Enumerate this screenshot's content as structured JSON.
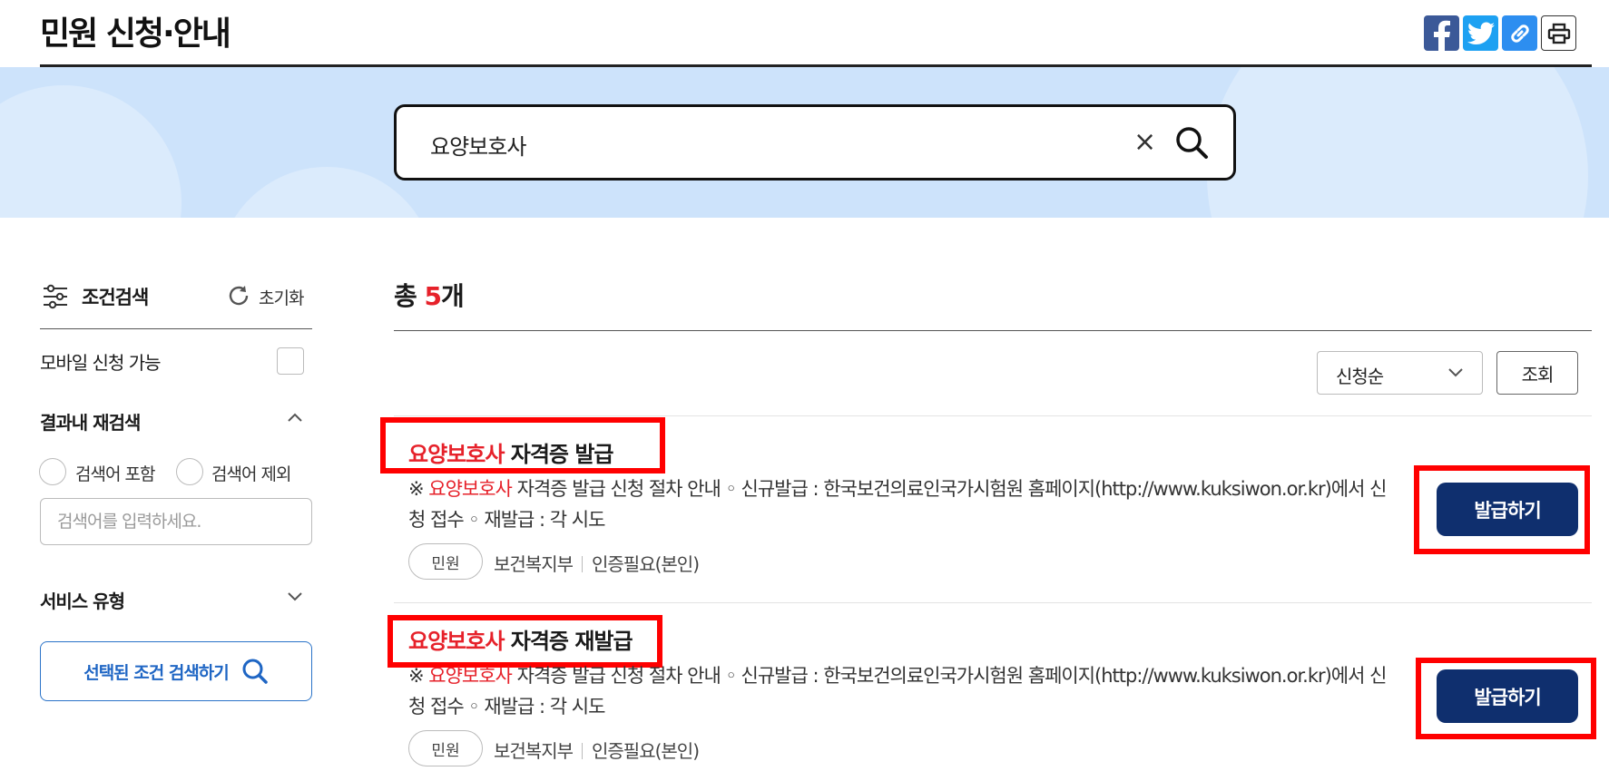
{
  "header": {
    "title": "민원 신청·안내",
    "share_buttons": [
      "facebook-icon",
      "twitter-icon",
      "link-icon",
      "print-icon"
    ]
  },
  "search": {
    "query": "요양보호사",
    "clear_glyph": "×"
  },
  "sidebar": {
    "title": "조건검색",
    "reset_label": "초기화",
    "mobile_label": "모바일 신청 가능",
    "refine_title": "결과내 재검색",
    "radio_include": "검색어 포함",
    "radio_exclude": "검색어 제외",
    "refine_placeholder": "검색어를 입력하세요.",
    "service_title": "서비스 유형",
    "apply_label": "선택된 조건 검색하기"
  },
  "results": {
    "total_prefix": "총",
    "total_count": "5",
    "total_suffix": "개",
    "sort_value": "신청순",
    "view_label": "조회",
    "items": [
      {
        "title_highlight": "요양보호사",
        "title_rest": " 자격증 발급",
        "desc_prefix": "※ ",
        "desc_highlight": "요양보호사",
        "desc_rest": " 자격증 발급 신청 절차 안내 ◦ 신규발급 : 한국보건의료인국가시험원 홈페이지(http://www.kuksiwon.or.kr)에서 신청 접수 ◦ 재발급 : 각 시도",
        "tag": "민원",
        "org": "보건복지부",
        "auth": "인증필요(본인)",
        "button": "발급하기"
      },
      {
        "title_highlight": "요양보호사",
        "title_rest": " 자격증 재발급",
        "desc_prefix": "※ ",
        "desc_highlight": "요양보호사",
        "desc_rest": " 자격증 발급 신청 절차 안내 ◦ 신규발급 : 한국보건의료인국가시험원 홈페이지(http://www.kuksiwon.or.kr)에서 신청 접수 ◦ 재발급 : 각 시도",
        "tag": "민원",
        "org": "보건복지부",
        "auth": "인증필요(본인)",
        "button": "발급하기"
      }
    ]
  },
  "colors": {
    "accent_red": "#e6212a",
    "navy_button": "#0f2f6e",
    "search_band": "#cde3fb",
    "facebook": "#3b5998",
    "twitter": "#1da1f2",
    "link": "#2d8ef0",
    "annotation_box": "#ff0000"
  }
}
